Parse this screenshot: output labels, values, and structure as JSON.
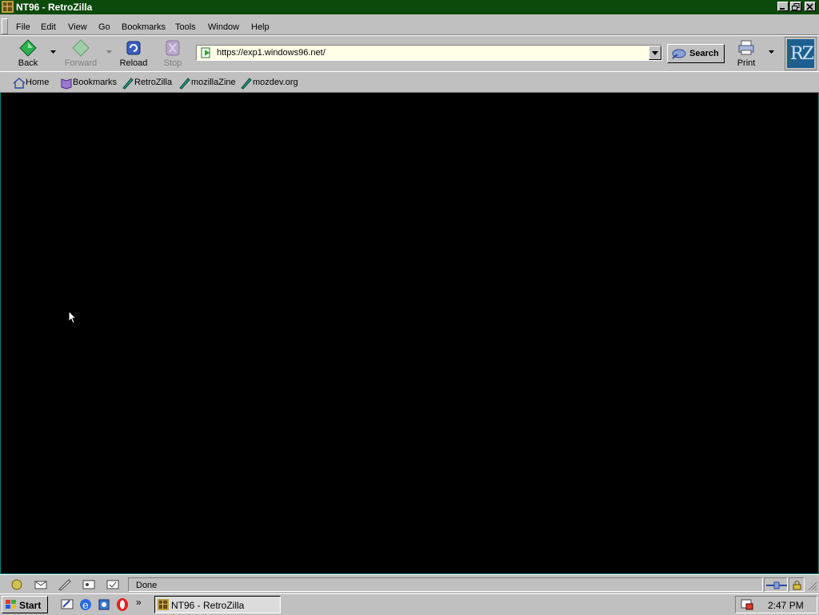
{
  "window": {
    "title": "NT96 - RetroZilla"
  },
  "menu": {
    "items": [
      "File",
      "Edit",
      "View",
      "Go",
      "Bookmarks",
      "Tools",
      "Window",
      "Help"
    ]
  },
  "nav": {
    "back_label": "Back",
    "forward_label": "Forward",
    "reload_label": "Reload",
    "stop_label": "Stop",
    "print_label": "Print",
    "search_label": "Search",
    "logo_text": "RZ"
  },
  "urlbar": {
    "value": "https://exp1.windows96.net/"
  },
  "personal_toolbar": {
    "items": [
      "Home",
      "Bookmarks",
      "RetroZilla",
      "mozillaZine",
      "mozdev.org"
    ]
  },
  "status": {
    "text": "Done"
  },
  "taskbar": {
    "start_label": "Start",
    "task_label": "NT96 - RetroZilla",
    "clock": "2:47 PM",
    "chevron": "»"
  },
  "colors": {
    "titlebar": "#0b4a0b",
    "content_bg": "#000000",
    "chrome": "#c0c0c0",
    "urlbar_bg": "#ffffe8"
  }
}
